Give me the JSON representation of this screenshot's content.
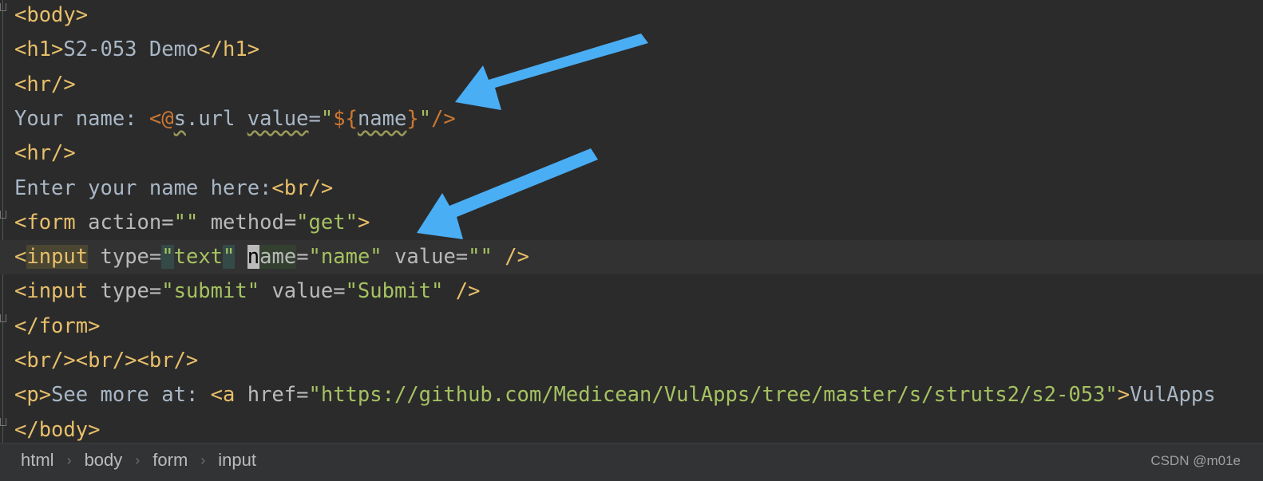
{
  "editor": {
    "lines": [
      {
        "tokens": [
          [
            "<body>",
            "t-tag"
          ]
        ]
      },
      {
        "tokens": [
          [
            "<h1>",
            "t-tag"
          ],
          [
            "S2-053 Demo",
            "t-text"
          ],
          [
            "</h1>",
            "t-tag"
          ]
        ]
      },
      {
        "tokens": [
          [
            "<hr/>",
            "t-tag"
          ]
        ]
      },
      {
        "tokens": [
          [
            "Your name: ",
            "t-text"
          ],
          [
            "<@",
            "t-ftl"
          ],
          [
            "s",
            "t-text t-wavy"
          ],
          [
            ".url ",
            "t-text"
          ],
          [
            "value",
            "t-text t-wavy"
          ],
          [
            "=",
            "t-text"
          ],
          [
            "\"",
            "t-str"
          ],
          [
            "${",
            "t-ftl"
          ],
          [
            "name",
            "t-text t-wavy"
          ],
          [
            "}",
            "t-ftl"
          ],
          [
            "\"",
            "t-str"
          ],
          [
            "/>",
            "t-ftl"
          ]
        ]
      },
      {
        "tokens": [
          [
            "<hr/>",
            "t-tag"
          ]
        ]
      },
      {
        "tokens": [
          [
            "Enter your name here:",
            "t-text"
          ],
          [
            "<br/>",
            "t-tag"
          ]
        ]
      },
      {
        "tokens": [
          [
            "<form ",
            "t-tag"
          ],
          [
            "action",
            "t-attr"
          ],
          [
            "=",
            "t-attr"
          ],
          [
            "\"\"",
            "t-str"
          ],
          [
            " ",
            "t-text"
          ],
          [
            "method",
            "t-attr"
          ],
          [
            "=",
            "t-attr"
          ],
          [
            "\"get\"",
            "t-str"
          ],
          [
            ">",
            "t-tag"
          ]
        ]
      },
      {
        "current": true,
        "tokens": [
          [
            "<",
            "t-tag"
          ],
          [
            "input",
            "t-tag t-hl-tag"
          ],
          [
            " ",
            "t-text"
          ],
          [
            "type",
            "t-attr"
          ],
          [
            "=",
            "t-attr"
          ],
          [
            "\"",
            "t-str t-hl-quote"
          ],
          [
            "text",
            "t-str"
          ],
          [
            "\"",
            "t-str t-hl-quote"
          ],
          [
            " ",
            "t-text"
          ],
          [
            "n",
            "t-caret"
          ],
          [
            "ame",
            "t-attr t-hl-name"
          ],
          [
            "=",
            "t-attr"
          ],
          [
            "\"name\"",
            "t-str"
          ],
          [
            " ",
            "t-text"
          ],
          [
            "value",
            "t-attr"
          ],
          [
            "=",
            "t-attr"
          ],
          [
            "\"\"",
            "t-str"
          ],
          [
            " />",
            "t-tag"
          ]
        ]
      },
      {
        "tokens": [
          [
            "<input ",
            "t-tag"
          ],
          [
            "type",
            "t-attr"
          ],
          [
            "=",
            "t-attr"
          ],
          [
            "\"submit\"",
            "t-str"
          ],
          [
            " ",
            "t-text"
          ],
          [
            "value",
            "t-attr"
          ],
          [
            "=",
            "t-attr"
          ],
          [
            "\"Submit\"",
            "t-str"
          ],
          [
            " />",
            "t-tag"
          ]
        ]
      },
      {
        "tokens": [
          [
            "</form>",
            "t-tag"
          ]
        ]
      },
      {
        "tokens": [
          [
            "<br/><br/><br/>",
            "t-tag"
          ]
        ]
      },
      {
        "tokens": [
          [
            "<p>",
            "t-tag"
          ],
          [
            "See more at: ",
            "t-text"
          ],
          [
            "<a ",
            "t-tag"
          ],
          [
            "href",
            "t-attr"
          ],
          [
            "=",
            "t-attr"
          ],
          [
            "\"https://github.com/Medicean/VulApps/tree/master/s/struts2/s2-053\"",
            "t-str"
          ],
          [
            ">",
            "t-tag"
          ],
          [
            "VulApps",
            "t-text"
          ]
        ]
      },
      {
        "tokens": [
          [
            "</body>",
            "t-tag"
          ]
        ]
      }
    ]
  },
  "breadcrumb": [
    "html",
    "body",
    "form",
    "input"
  ],
  "breadcrumb_separator": "›",
  "watermark": "CSDN @m01e",
  "colors": {
    "background": "#2b2b2b",
    "tag": "#e8bf6a",
    "string": "#a5c261",
    "text": "#a9b7c6",
    "freemarker": "#cc7832",
    "arrow": "#4aaef5"
  }
}
